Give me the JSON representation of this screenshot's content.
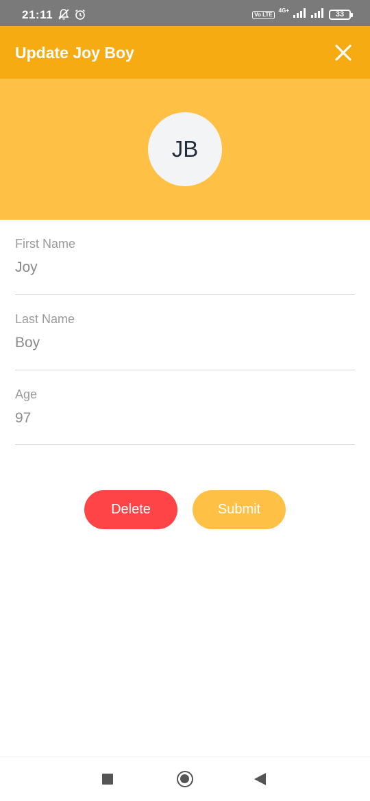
{
  "status_bar": {
    "time": "21:11",
    "volte": "Vo LTE",
    "network": "4G+",
    "battery": "33",
    "icons": [
      "mute-notifications-icon",
      "alarm-icon",
      "volte-icon",
      "signal-icon",
      "signal-icon",
      "battery-icon"
    ]
  },
  "app_bar": {
    "title": "Update Joy Boy",
    "close_icon": "close-icon"
  },
  "avatar": {
    "initials": "JB"
  },
  "form": {
    "first_name": {
      "label": "First Name",
      "value": "Joy"
    },
    "last_name": {
      "label": "Last Name",
      "value": "Boy"
    },
    "age": {
      "label": "Age",
      "value": "97"
    }
  },
  "actions": {
    "delete_label": "Delete",
    "submit_label": "Submit"
  },
  "nav_bar": {
    "icons": [
      "recents-icon",
      "home-icon",
      "back-icon"
    ]
  },
  "colors": {
    "app_bar": "#f5ab11",
    "header": "#ffc145",
    "delete": "#ff4447",
    "submit": "#ffc145"
  }
}
